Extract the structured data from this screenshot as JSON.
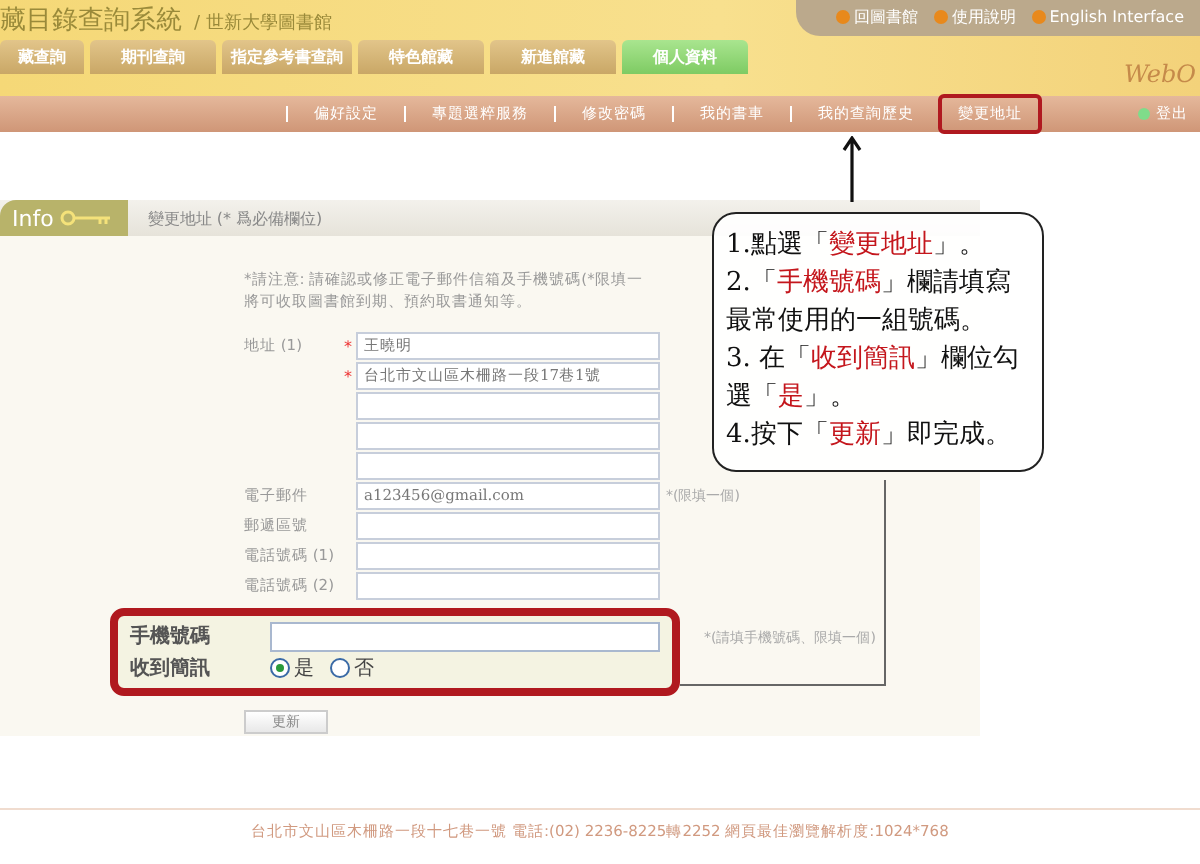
{
  "header": {
    "system_title": "藏目錄查詢系統",
    "library": "/ 世新大學圖書館",
    "logo_text": "WebO",
    "top_links": [
      {
        "label": "回圖書館"
      },
      {
        "label": "使用說明"
      },
      {
        "label": "English Interface"
      }
    ],
    "tabs": [
      {
        "label": "藏查詢",
        "selected": false
      },
      {
        "label": "期刊查詢",
        "selected": false
      },
      {
        "label": "指定參考書查詢",
        "selected": false
      },
      {
        "label": "特色館藏",
        "selected": false
      },
      {
        "label": "新進館藏",
        "selected": false
      },
      {
        "label": "個人資料",
        "selected": true
      }
    ]
  },
  "subnav": {
    "items": [
      {
        "label": "偏好設定",
        "selected": false
      },
      {
        "label": "專題選粹服務",
        "selected": false
      },
      {
        "label": "修改密碼",
        "selected": false
      },
      {
        "label": "我的書車",
        "selected": false
      },
      {
        "label": "我的查詢歷史",
        "selected": false
      },
      {
        "label": "變更地址",
        "selected": true
      }
    ],
    "logout": "登出"
  },
  "section": {
    "tab": "Info",
    "title": "變更地址 (* 爲必備欄位)"
  },
  "notice": [
    "*請注意: 請確認或修正電子郵件信箱及手機號碼(*限填一",
    "將可收取圖書館到期、預約取書通知等。"
  ],
  "fields": [
    {
      "kind": "input",
      "label": "地址 (1)",
      "mark": "*",
      "value": "王曉明"
    },
    {
      "kind": "input",
      "mark": "*",
      "value": "台北市文山區木柵路一段17巷1號"
    },
    {
      "kind": "input"
    },
    {
      "kind": "input"
    },
    {
      "kind": "input"
    },
    {
      "kind": "input",
      "label": "電子郵件",
      "value": "a123456@gmail.com",
      "hint": "*(限填一個)"
    },
    {
      "kind": "input",
      "label": "郵遞區號"
    },
    {
      "kind": "input",
      "label": "電話號碼 (1)"
    },
    {
      "kind": "input",
      "label": "電話號碼 (2)"
    }
  ],
  "mobile": {
    "label": "手機號碼",
    "hint": "*(請填手機號碼、限填一個)"
  },
  "sms": {
    "label": "收到簡訊",
    "options": [
      {
        "label": "是",
        "selected": true
      },
      {
        "label": "否",
        "selected": false
      }
    ]
  },
  "update_button": "更新",
  "callout": {
    "steps": [
      [
        {
          "text": "1.點選「"
        },
        {
          "text": "變更地址",
          "red": true
        },
        {
          "text": "」。"
        }
      ],
      [
        {
          "text": "2.「"
        },
        {
          "text": "手機號碼",
          "red": true
        },
        {
          "text": "」欄請填寫最常使用的一組號碼。"
        }
      ],
      [
        {
          "text": "3. 在「"
        },
        {
          "text": "收到簡訊",
          "red": true
        },
        {
          "text": "」欄位勾選「"
        },
        {
          "text": "是",
          "red": true
        },
        {
          "text": "」。"
        }
      ],
      [
        {
          "text": "4.按下「"
        },
        {
          "text": "更新",
          "red": true
        },
        {
          "text": "」即完成。"
        }
      ]
    ]
  },
  "footer": "台北市文山區木柵路一段十七巷一號 電話:(02) 2236-8225轉2252 網頁最佳瀏覽解析度:1024*768"
}
